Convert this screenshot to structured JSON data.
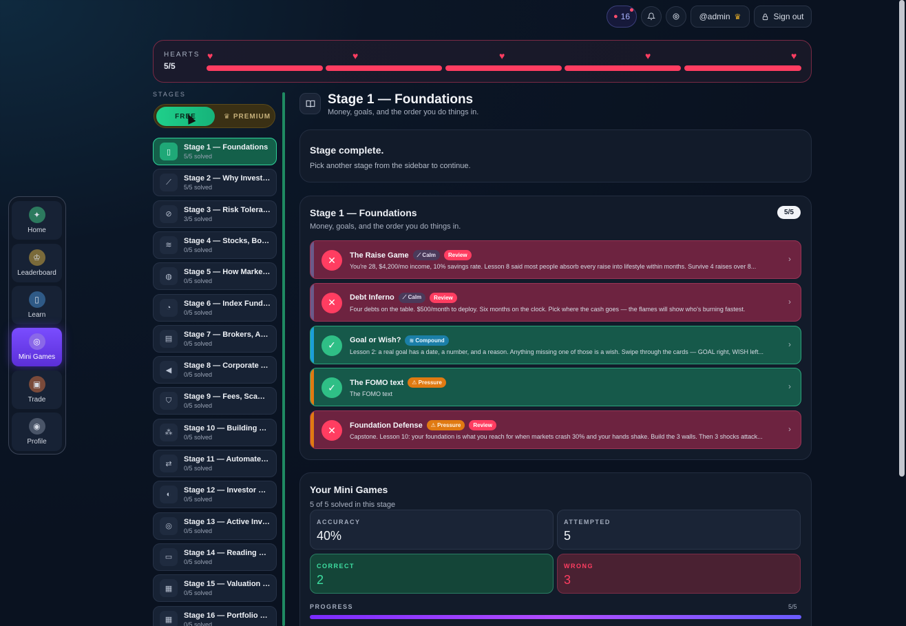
{
  "topbar": {
    "streak_count": "16",
    "username": "@admin",
    "sign_out": "Sign out"
  },
  "hearts": {
    "label": "HEARTS",
    "value": "5/5",
    "filled": 5,
    "total": 5
  },
  "nav": [
    {
      "label": "Home",
      "icon": "sparkle-icon",
      "active": false
    },
    {
      "label": "Leaderboard",
      "icon": "trophy-icon",
      "active": false
    },
    {
      "label": "Learn",
      "icon": "book-icon",
      "active": false
    },
    {
      "label": "Mini Games",
      "icon": "gamepad-icon",
      "active": true
    },
    {
      "label": "Trade",
      "icon": "briefcase-icon",
      "active": false
    },
    {
      "label": "Profile",
      "icon": "user-icon",
      "active": false
    }
  ],
  "stages_header": "STAGES",
  "toggle": {
    "free": "FREE",
    "premium": "PREMIUM"
  },
  "stages": [
    {
      "title": "Stage 1 — Foundations",
      "solved": "5/5 solved",
      "icon": "book-icon"
    },
    {
      "title": "Stage 2 — Why Investi...",
      "solved": "5/5 solved",
      "icon": "chart-icon"
    },
    {
      "title": "Stage 3 — Risk Toleran...",
      "solved": "3/5 solved",
      "icon": "compass-icon"
    },
    {
      "title": "Stage 4 — Stocks, Bon...",
      "solved": "0/5 solved",
      "icon": "layers-icon"
    },
    {
      "title": "Stage 5 — How Market...",
      "solved": "0/5 solved",
      "icon": "globe-icon"
    },
    {
      "title": "Stage 6 — Index Funds,...",
      "solved": "0/5 solved",
      "icon": "pie-icon"
    },
    {
      "title": "Stage 7 — Brokers, Acc...",
      "solved": "0/5 solved",
      "icon": "bank-icon"
    },
    {
      "title": "Stage 8 — Corporate A...",
      "solved": "0/5 solved",
      "icon": "megaphone-icon"
    },
    {
      "title": "Stage 9 — Fees, Scams...",
      "solved": "0/5 solved",
      "icon": "shield-icon"
    },
    {
      "title": "Stage 10 — Building Yo...",
      "solved": "0/5 solved",
      "icon": "blocks-icon"
    },
    {
      "title": "Stage 11 — Automate, ...",
      "solved": "0/5 solved",
      "icon": "repeat-icon"
    },
    {
      "title": "Stage 12 — Investor Ps...",
      "solved": "0/5 solved",
      "icon": "brain-icon"
    },
    {
      "title": "Stage 13 — Active Inve...",
      "solved": "0/5 solved",
      "icon": "target-icon"
    },
    {
      "title": "Stage 14 — Reading Fin...",
      "solved": "0/5 solved",
      "icon": "document-icon"
    },
    {
      "title": "Stage 15 — Valuation fo...",
      "solved": "0/5 solved",
      "icon": "calculator-icon"
    },
    {
      "title": "Stage 16 — Portfolio Co...",
      "solved": "0/5 solved",
      "icon": "grid-icon"
    }
  ],
  "main": {
    "title": "Stage 1 — Foundations",
    "subtitle": "Money, goals, and the order you do things in.",
    "complete_title": "Stage complete.",
    "complete_sub": "Pick another stage from the sidebar to continue.",
    "section_title": "Stage 1 — Foundations",
    "section_sub": "Money, goals, and the order you do things in.",
    "section_count": "5/5"
  },
  "games": [
    {
      "title": "The Raise Game",
      "status": "fail",
      "tags": [
        {
          "kind": "calm",
          "label": "Calm"
        },
        {
          "kind": "review",
          "label": "Review"
        }
      ],
      "desc": "You're 28, $4,200/mo income, 10% savings rate. Lesson 8 said most people absorb every raise into lifestyle within months. Survive 4 raises over 8...",
      "stripe": "#6a5a8a"
    },
    {
      "title": "Debt Inferno",
      "status": "fail",
      "tags": [
        {
          "kind": "calm",
          "label": "Calm"
        },
        {
          "kind": "review",
          "label": "Review"
        }
      ],
      "desc": "Four debts on the table. $500/month to deploy. Six months on the clock. Pick where the cash goes — the flames will show who's burning fastest.",
      "stripe": "#6a5a8a"
    },
    {
      "title": "Goal or Wish?",
      "status": "pass",
      "tags": [
        {
          "kind": "compound",
          "label": "Compound"
        }
      ],
      "desc": "Lesson 2: a real goal has a date, a number, and a reason. Anything missing one of those is a wish. Swipe through the cards — GOAL right, WISH left...",
      "stripe": "#1b9fd8"
    },
    {
      "title": "The FOMO text",
      "status": "pass",
      "tags": [
        {
          "kind": "pressure",
          "label": "Pressure"
        }
      ],
      "desc": "The FOMO text",
      "stripe": "#e07a12"
    },
    {
      "title": "Foundation Defense",
      "status": "fail",
      "tags": [
        {
          "kind": "pressure",
          "label": "Pressure"
        },
        {
          "kind": "review",
          "label": "Review"
        }
      ],
      "desc": "Capstone. Lesson 10: your foundation is what you reach for when markets crash 30% and your hands shake. Build the 3 walls. Then 3 shocks attack...",
      "stripe": "#e07a12"
    }
  ],
  "mini_games": {
    "title": "Your Mini Games",
    "sub": "5 of 5 solved in this stage",
    "accuracy_label": "ACCURACY",
    "accuracy": "40%",
    "attempted_label": "ATTEMPTED",
    "attempted": "5",
    "correct_label": "CORRECT",
    "correct": "2",
    "wrong_label": "WRONG",
    "wrong": "3",
    "progress_label": "PROGRESS",
    "progress": "5/5",
    "progress_fraction": 1.0
  },
  "colors": {
    "accent_green": "#2fd39a",
    "accent_red": "#ff3d61",
    "accent_purple": "#7a4dff"
  }
}
